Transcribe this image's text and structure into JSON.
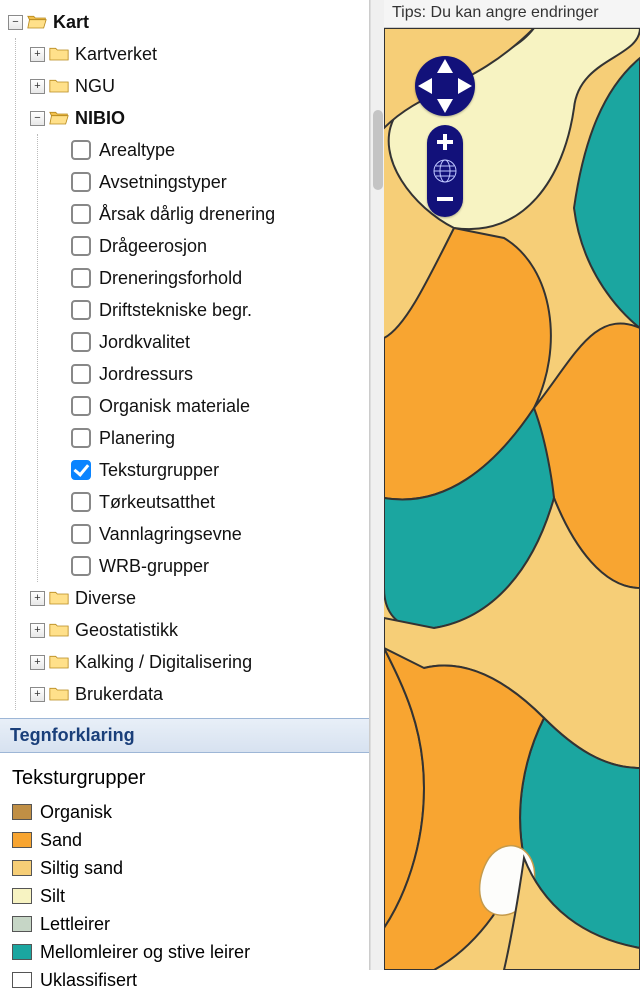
{
  "tree": {
    "root": {
      "label": "Kart",
      "expanded": true
    },
    "kartverket": {
      "label": "Kartverket"
    },
    "ngu": {
      "label": "NGU"
    },
    "nibio": {
      "label": "NIBIO",
      "expanded": true
    },
    "layers": [
      {
        "label": "Arealtype",
        "checked": false
      },
      {
        "label": "Avsetningstyper",
        "checked": false
      },
      {
        "label": "Årsak dårlig drenering",
        "checked": false
      },
      {
        "label": "Drågeerosjon",
        "checked": false
      },
      {
        "label": "Dreneringsforhold",
        "checked": false
      },
      {
        "label": "Driftstekniske begr.",
        "checked": false
      },
      {
        "label": "Jordkvalitet",
        "checked": false
      },
      {
        "label": "Jordressurs",
        "checked": false
      },
      {
        "label": "Organisk materiale",
        "checked": false
      },
      {
        "label": "Planering",
        "checked": false
      },
      {
        "label": "Teksturgrupper",
        "checked": true
      },
      {
        "label": "Tørkeutsatthet",
        "checked": false
      },
      {
        "label": "Vannlagringsevne",
        "checked": false
      },
      {
        "label": "WRB-grupper",
        "checked": false
      }
    ],
    "diverse": {
      "label": "Diverse"
    },
    "geostat": {
      "label": "Geostatistikk"
    },
    "kalking": {
      "label": "Kalking / Digitalisering"
    },
    "bruker": {
      "label": "Brukerdata"
    }
  },
  "legend": {
    "header": "Tegnforklaring",
    "title": "Teksturgrupper",
    "items": [
      {
        "label": "Organisk",
        "color": "#c08f45"
      },
      {
        "label": "Sand",
        "color": "#f8a531"
      },
      {
        "label": "Siltig sand",
        "color": "#f6ce77"
      },
      {
        "label": "Silt",
        "color": "#f7f3c2"
      },
      {
        "label": "Lettleirer",
        "color": "#c6d6c6"
      },
      {
        "label": "Mellomleirer og stive leirer",
        "color": "#1ba6a0"
      },
      {
        "label": "Uklassifisert",
        "color": "#ffffff"
      }
    ]
  },
  "tips": "Tips: Du kan angre endringer",
  "glyphs": {
    "plus": "+",
    "minus": "−"
  }
}
